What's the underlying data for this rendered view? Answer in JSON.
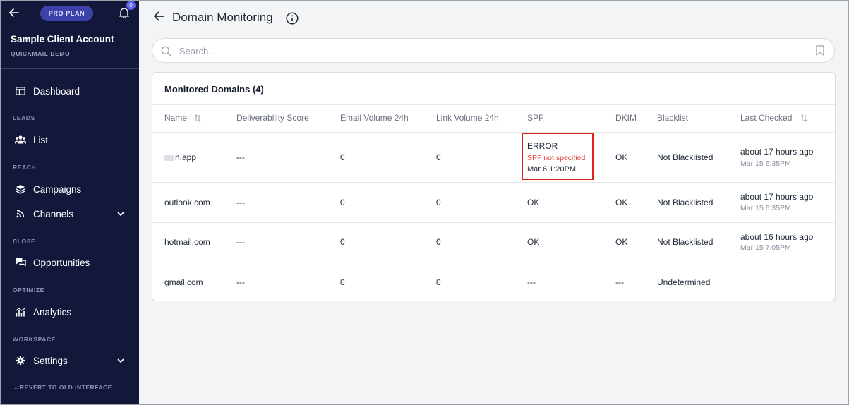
{
  "sidebar": {
    "plan": "PRO PLAN",
    "notification_count": "0",
    "account_name": "Sample Client Account",
    "account_sub": "QUICKMAIL DEMO",
    "items": [
      {
        "label": "Dashboard",
        "icon": "dashboard-icon"
      },
      {
        "label": "List",
        "icon": "users-icon"
      },
      {
        "label": "Campaigns",
        "icon": "layers-icon"
      },
      {
        "label": "Channels",
        "icon": "rss-icon"
      },
      {
        "label": "Opportunities",
        "icon": "chat-icon"
      },
      {
        "label": "Analytics",
        "icon": "bar-chart-icon"
      },
      {
        "label": "Settings",
        "icon": "gear-icon"
      }
    ],
    "sections": [
      "LEADS",
      "REACH",
      "CLOSE",
      "OPTIMIZE",
      "WORKSPACE"
    ],
    "revert": "←REVERT TO OLD INTERFACE"
  },
  "header": {
    "title": "Domain Monitoring"
  },
  "search": {
    "placeholder": "Search..."
  },
  "table": {
    "title": "Monitored Domains (4)",
    "columns": [
      "Name",
      "Deliverability Score",
      "Email Volume 24h",
      "Link Volume 24h",
      "SPF",
      "DKIM",
      "Blacklist",
      "Last Checked"
    ],
    "rows": [
      {
        "name": "n.app",
        "score": "---",
        "email_volume": "0",
        "link_volume": "0",
        "spf": "ERROR",
        "spf_detail": "SPF not specified",
        "spf_date": "Mar 6 1:20PM",
        "dkim": "OK",
        "blacklist": "Not Blacklisted",
        "last_checked": "about 17 hours ago",
        "last_checked_date": "Mar 15 6:35PM"
      },
      {
        "name": "outlook.com",
        "score": "---",
        "email_volume": "0",
        "link_volume": "0",
        "spf": "OK",
        "dkim": "OK",
        "blacklist": "Not Blacklisted",
        "last_checked": "about 17 hours ago",
        "last_checked_date": "Mar 15 6:35PM"
      },
      {
        "name": "hotmail.com",
        "score": "---",
        "email_volume": "0",
        "link_volume": "0",
        "spf": "OK",
        "dkim": "OK",
        "blacklist": "Not Blacklisted",
        "last_checked": "about 16 hours ago",
        "last_checked_date": "Mar 15 7:05PM"
      },
      {
        "name": "gmail.com",
        "score": "---",
        "email_volume": "0",
        "link_volume": "0",
        "spf": "---",
        "dkim": "---",
        "blacklist": "Undetermined"
      }
    ]
  },
  "colors": {
    "sidebar_bg": "#13183a",
    "plan_pill": "#3c42a8",
    "error_red": "#e0413f",
    "highlight_red": "#e02424"
  }
}
